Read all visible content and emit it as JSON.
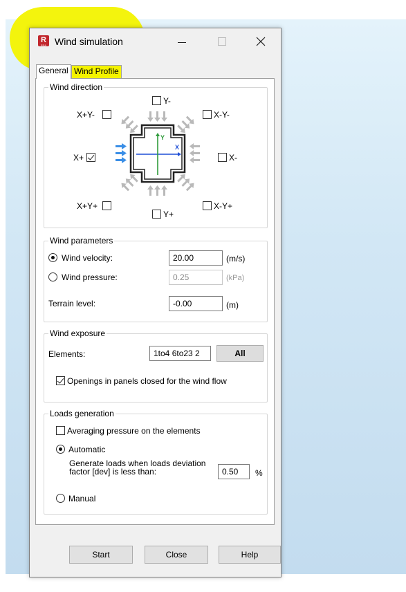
{
  "window": {
    "title": "Wind simulation",
    "app_icon_letter": "R",
    "app_icon_sub": "RSA"
  },
  "tabs": [
    {
      "label": "General",
      "active": true
    },
    {
      "label": "Wind Profile",
      "active": false
    }
  ],
  "wind_direction": {
    "group_label": "Wind direction",
    "checkboxes": [
      {
        "label": "Y-",
        "checked": false
      },
      {
        "label": "X+Y-",
        "checked": false
      },
      {
        "label": "X-Y-",
        "checked": false
      },
      {
        "label": "X+",
        "checked": true
      },
      {
        "label": "X-",
        "checked": false
      },
      {
        "label": "X+Y+",
        "checked": false
      },
      {
        "label": "X-Y+",
        "checked": false
      },
      {
        "label": "Y+",
        "checked": false
      }
    ],
    "diagram": {
      "axis_x": "X",
      "axis_y": "Y"
    }
  },
  "wind_parameters": {
    "group_label": "Wind parameters",
    "velocity": {
      "label": "Wind velocity:",
      "value": "20.00",
      "unit": "(m/s)",
      "selected": true
    },
    "pressure": {
      "label": "Wind pressure:",
      "value": "0.25",
      "unit": "(kPa)",
      "selected": false
    },
    "terrain": {
      "label": "Terrain level:",
      "value": "-0.00",
      "unit": "(m)"
    }
  },
  "wind_exposure": {
    "group_label": "Wind exposure",
    "elements_label": "Elements:",
    "elements_value": "1to4 6to23 2",
    "all_button": "All",
    "openings_label": "Openings in panels closed for the wind flow",
    "openings_checked": true
  },
  "loads_generation": {
    "group_label": "Loads generation",
    "averaging_label": "Averaging pressure on the elements",
    "averaging_checked": false,
    "automatic_label": "Automatic",
    "automatic_selected": true,
    "generate_text_line1": "Generate loads when loads deviation",
    "generate_text_line2": "factor [dev] is less than:",
    "dev_value": "0.50",
    "dev_unit": "%",
    "manual_label": "Manual",
    "manual_selected": false
  },
  "footer": {
    "start": "Start",
    "close": "Close",
    "help": "Help"
  },
  "colors": {
    "highlight": "#f3f300",
    "arrow_active": "#3a8ee6",
    "arrow_inactive": "#b9b9b9",
    "axis_x": "#1f4fd6",
    "axis_y": "#2e9b3a"
  }
}
